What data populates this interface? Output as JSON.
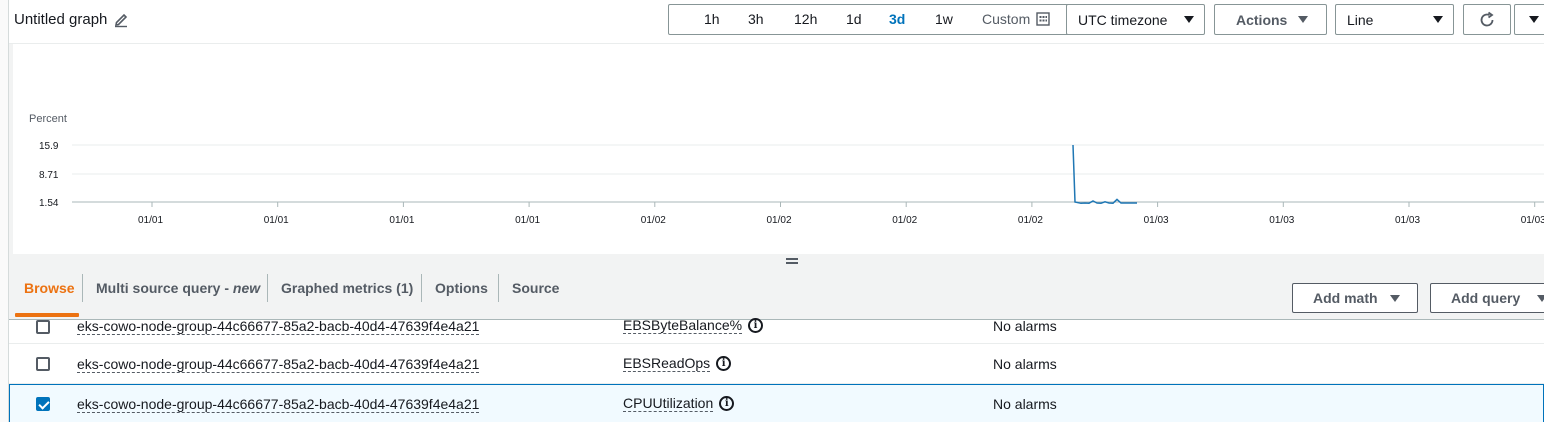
{
  "header": {
    "title": "Untitled graph",
    "ranges": [
      "1h",
      "3h",
      "12h",
      "1d",
      "3d",
      "1w"
    ],
    "active_range": "3d",
    "custom_label": "Custom",
    "timezone_label": "UTC timezone",
    "actions_label": "Actions",
    "chart_type_label": "Line"
  },
  "chart_data": {
    "type": "line",
    "ylabel": "Percent",
    "y_ticks": [
      "15.9",
      "8.71",
      "1.54"
    ],
    "x_ticks": [
      "01/01",
      "01/01",
      "01/01",
      "01/01",
      "01/02",
      "01/02",
      "01/02",
      "01/02",
      "01/03",
      "01/03",
      "01/03",
      "01/03"
    ],
    "grid": true,
    "colors": {
      "series": "#1f77b4",
      "grid": "#eaeded"
    },
    "series": [
      {
        "values": [
          15.9,
          1.54,
          1.2,
          1.3,
          1.25,
          1.8,
          1.3,
          1.25,
          1.6,
          1.3,
          1.25,
          2.2,
          1.3,
          1.3,
          1.3,
          1.3,
          1.3
        ]
      }
    ]
  },
  "tabs": {
    "items": [
      "Browse",
      "Multi source query - ",
      "Graphed metrics (1)",
      "Options",
      "Source"
    ],
    "multi_new": "new",
    "active": "Browse",
    "add_math_label": "Add math",
    "add_query_label": "Add query"
  },
  "rows": [
    {
      "node": "eks-cowo-node-group-44c66677-85a2-bacb-40d4-47639f4e4a21",
      "metric": "EBSByteBalance%",
      "alarm": "No alarms",
      "checked": false
    },
    {
      "node": "eks-cowo-node-group-44c66677-85a2-bacb-40d4-47639f4e4a21",
      "metric": "EBSReadOps",
      "alarm": "No alarms",
      "checked": false
    },
    {
      "node": "eks-cowo-node-group-44c66677-85a2-bacb-40d4-47639f4e4a21",
      "metric": "CPUUtilization",
      "alarm": "No alarms",
      "checked": true
    }
  ],
  "icons": {
    "title_edit": "pencil-icon",
    "custom": "calendar-icon",
    "refresh": "refresh-icon",
    "info": "info-icon",
    "splitter": "drag-handle-icon"
  }
}
